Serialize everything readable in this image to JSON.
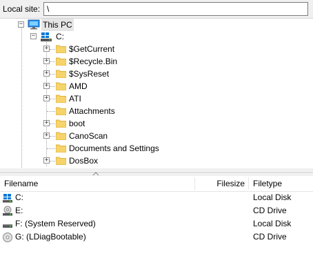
{
  "site": {
    "label": "Local site:",
    "path": "\\"
  },
  "tree": {
    "root": "This PC",
    "drive": "C:",
    "folders": [
      {
        "label": "$GetCurrent",
        "expandable": true
      },
      {
        "label": "$Recycle.Bin",
        "expandable": true
      },
      {
        "label": "$SysReset",
        "expandable": true
      },
      {
        "label": "AMD",
        "expandable": true
      },
      {
        "label": "ATI",
        "expandable": true
      },
      {
        "label": "Attachments",
        "expandable": false
      },
      {
        "label": "boot",
        "expandable": true
      },
      {
        "label": "CanoScan",
        "expandable": true
      },
      {
        "label": "Documents and Settings",
        "expandable": false
      },
      {
        "label": "DosBox",
        "expandable": true
      }
    ]
  },
  "list": {
    "columns": {
      "filename": "Filename",
      "filesize": "Filesize",
      "filetype": "Filetype"
    },
    "rows": [
      {
        "name": "C:",
        "type": "Local Disk",
        "icon": "local-disk-windows-icon"
      },
      {
        "name": "E:",
        "type": "CD Drive",
        "icon": "cd-drive-icon"
      },
      {
        "name": "F: (System Reserved)",
        "type": "Local Disk",
        "icon": "local-disk-icon"
      },
      {
        "name": "G: (LDiagBootable)",
        "type": "CD Drive",
        "icon": "cd-disc-icon"
      }
    ]
  },
  "colors": {
    "folder": "#f6d36b",
    "folder_dark": "#e1b23b",
    "monitor": "#1e90ff",
    "windows": "#0078d7"
  }
}
